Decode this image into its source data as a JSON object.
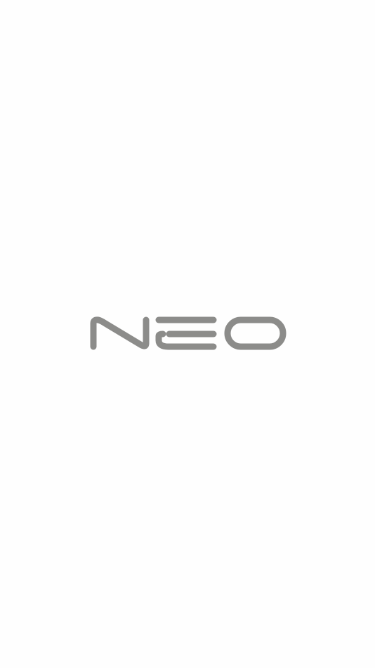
{
  "splash": {
    "logo": {
      "wordmark": "NEO",
      "color": "#8c8c8a"
    },
    "background_color": "#fefefe"
  }
}
